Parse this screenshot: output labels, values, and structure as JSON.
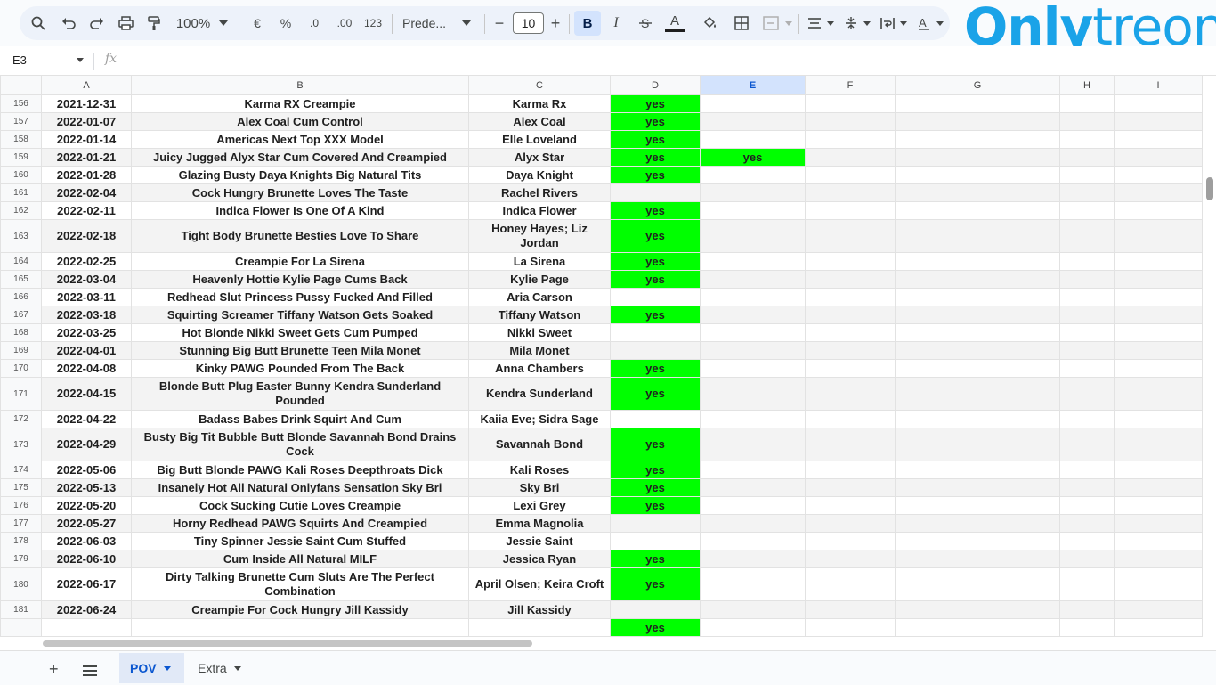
{
  "toolbar": {
    "zoom": "100%",
    "currency": "€",
    "percent": "%",
    "dec_decrease": ".0",
    "dec_increase": ".00",
    "number_format": "123",
    "font": "Prede...",
    "font_size": "10",
    "bold": "B",
    "italic": "I",
    "text_color": "A"
  },
  "logo": {
    "part1": "Only",
    "part2": "treon"
  },
  "formula_bar": {
    "cell_ref": "E3",
    "fx": "fx"
  },
  "columns": [
    "A",
    "B",
    "C",
    "D",
    "E",
    "F",
    "G",
    "H",
    "I"
  ],
  "selected_column": "E",
  "rows": [
    {
      "n": "156",
      "a": "2021-12-31",
      "b": "Karma RX Creampie",
      "c": "Karma Rx",
      "d": "yes",
      "e": ""
    },
    {
      "n": "157",
      "a": "2022-01-07",
      "b": "Alex Coal Cum Control",
      "c": "Alex Coal",
      "d": "yes",
      "e": ""
    },
    {
      "n": "158",
      "a": "2022-01-14",
      "b": "Americas Next Top XXX Model",
      "c": "Elle Loveland",
      "d": "yes",
      "e": ""
    },
    {
      "n": "159",
      "a": "2022-01-21",
      "b": "Juicy Jugged Alyx Star Cum Covered And Creampied",
      "c": "Alyx Star",
      "d": "yes",
      "e": "yes"
    },
    {
      "n": "160",
      "a": "2022-01-28",
      "b": "Glazing Busty Daya Knights Big Natural Tits",
      "c": "Daya Knight",
      "d": "yes",
      "e": ""
    },
    {
      "n": "161",
      "a": "2022-02-04",
      "b": "Cock Hungry Brunette Loves The Taste",
      "c": "Rachel Rivers",
      "d": "",
      "e": ""
    },
    {
      "n": "162",
      "a": "2022-02-11",
      "b": "Indica Flower Is One Of A Kind",
      "c": "Indica Flower",
      "d": "yes",
      "e": ""
    },
    {
      "n": "163",
      "a": "2022-02-18",
      "b": "Tight Body Brunette Besties Love To Share",
      "c": "Honey Hayes; Liz Jordan",
      "d": "yes",
      "e": ""
    },
    {
      "n": "164",
      "a": "2022-02-25",
      "b": "Creampie For La Sirena",
      "c": "La Sirena",
      "d": "yes",
      "e": ""
    },
    {
      "n": "165",
      "a": "2022-03-04",
      "b": "Heavenly Hottie Kylie Page Cums Back",
      "c": "Kylie Page",
      "d": "yes",
      "e": ""
    },
    {
      "n": "166",
      "a": "2022-03-11",
      "b": "Redhead Slut Princess Pussy Fucked And Filled",
      "c": "Aria Carson",
      "d": "",
      "e": ""
    },
    {
      "n": "167",
      "a": "2022-03-18",
      "b": "Squirting Screamer Tiffany Watson Gets Soaked",
      "c": "Tiffany Watson",
      "d": "yes",
      "e": ""
    },
    {
      "n": "168",
      "a": "2022-03-25",
      "b": "Hot Blonde Nikki Sweet Gets Cum Pumped",
      "c": "Nikki Sweet",
      "d": "",
      "e": ""
    },
    {
      "n": "169",
      "a": "2022-04-01",
      "b": "Stunning Big Butt Brunette Teen Mila Monet",
      "c": "Mila Monet",
      "d": "",
      "e": ""
    },
    {
      "n": "170",
      "a": "2022-04-08",
      "b": "Kinky PAWG Pounded From The Back",
      "c": "Anna Chambers",
      "d": "yes",
      "e": ""
    },
    {
      "n": "171",
      "a": "2022-04-15",
      "b": "Blonde Butt Plug Easter Bunny Kendra Sunderland Pounded",
      "c": "Kendra Sunderland",
      "d": "yes",
      "e": ""
    },
    {
      "n": "172",
      "a": "2022-04-22",
      "b": "Badass Babes Drink Squirt And Cum",
      "c": "Kaiia Eve; Sidra Sage",
      "d": "",
      "e": ""
    },
    {
      "n": "173",
      "a": "2022-04-29",
      "b": "Busty Big Tit Bubble Butt Blonde Savannah Bond Drains Cock",
      "c": "Savannah Bond",
      "d": "yes",
      "e": ""
    },
    {
      "n": "174",
      "a": "2022-05-06",
      "b": "Big Butt Blonde PAWG Kali Roses Deepthroats Dick",
      "c": "Kali Roses",
      "d": "yes",
      "e": ""
    },
    {
      "n": "175",
      "a": "2022-05-13",
      "b": "Insanely Hot All Natural Onlyfans Sensation Sky Bri",
      "c": "Sky Bri",
      "d": "yes",
      "e": ""
    },
    {
      "n": "176",
      "a": "2022-05-20",
      "b": "Cock Sucking Cutie Loves Creampie",
      "c": "Lexi Grey",
      "d": "yes",
      "e": ""
    },
    {
      "n": "177",
      "a": "2022-05-27",
      "b": "Horny Redhead PAWG Squirts And Creampied",
      "c": "Emma Magnolia",
      "d": "",
      "e": ""
    },
    {
      "n": "178",
      "a": "2022-06-03",
      "b": "Tiny Spinner Jessie Saint Cum Stuffed",
      "c": "Jessie Saint",
      "d": "",
      "e": ""
    },
    {
      "n": "179",
      "a": "2022-06-10",
      "b": "Cum Inside All Natural MILF",
      "c": "Jessica Ryan",
      "d": "yes",
      "e": ""
    },
    {
      "n": "180",
      "a": "2022-06-17",
      "b": "Dirty Talking Brunette Cum Sluts Are The Perfect Combination",
      "c": "April Olsen; Keira Croft",
      "d": "yes",
      "e": ""
    },
    {
      "n": "181",
      "a": "2022-06-24",
      "b": "Creampie For Cock Hungry Jill Kassidy",
      "c": "Jill Kassidy",
      "d": "",
      "e": ""
    },
    {
      "n": "",
      "a": "",
      "b": "",
      "c": "",
      "d": "yes",
      "e": ""
    }
  ],
  "sheet_tabs": [
    {
      "label": "POV",
      "active": true
    },
    {
      "label": "Extra",
      "active": false
    }
  ],
  "colors": {
    "yes_fill": "#00ff00",
    "selected_header": "#d3e3fd",
    "accent": "#0b57d0"
  }
}
